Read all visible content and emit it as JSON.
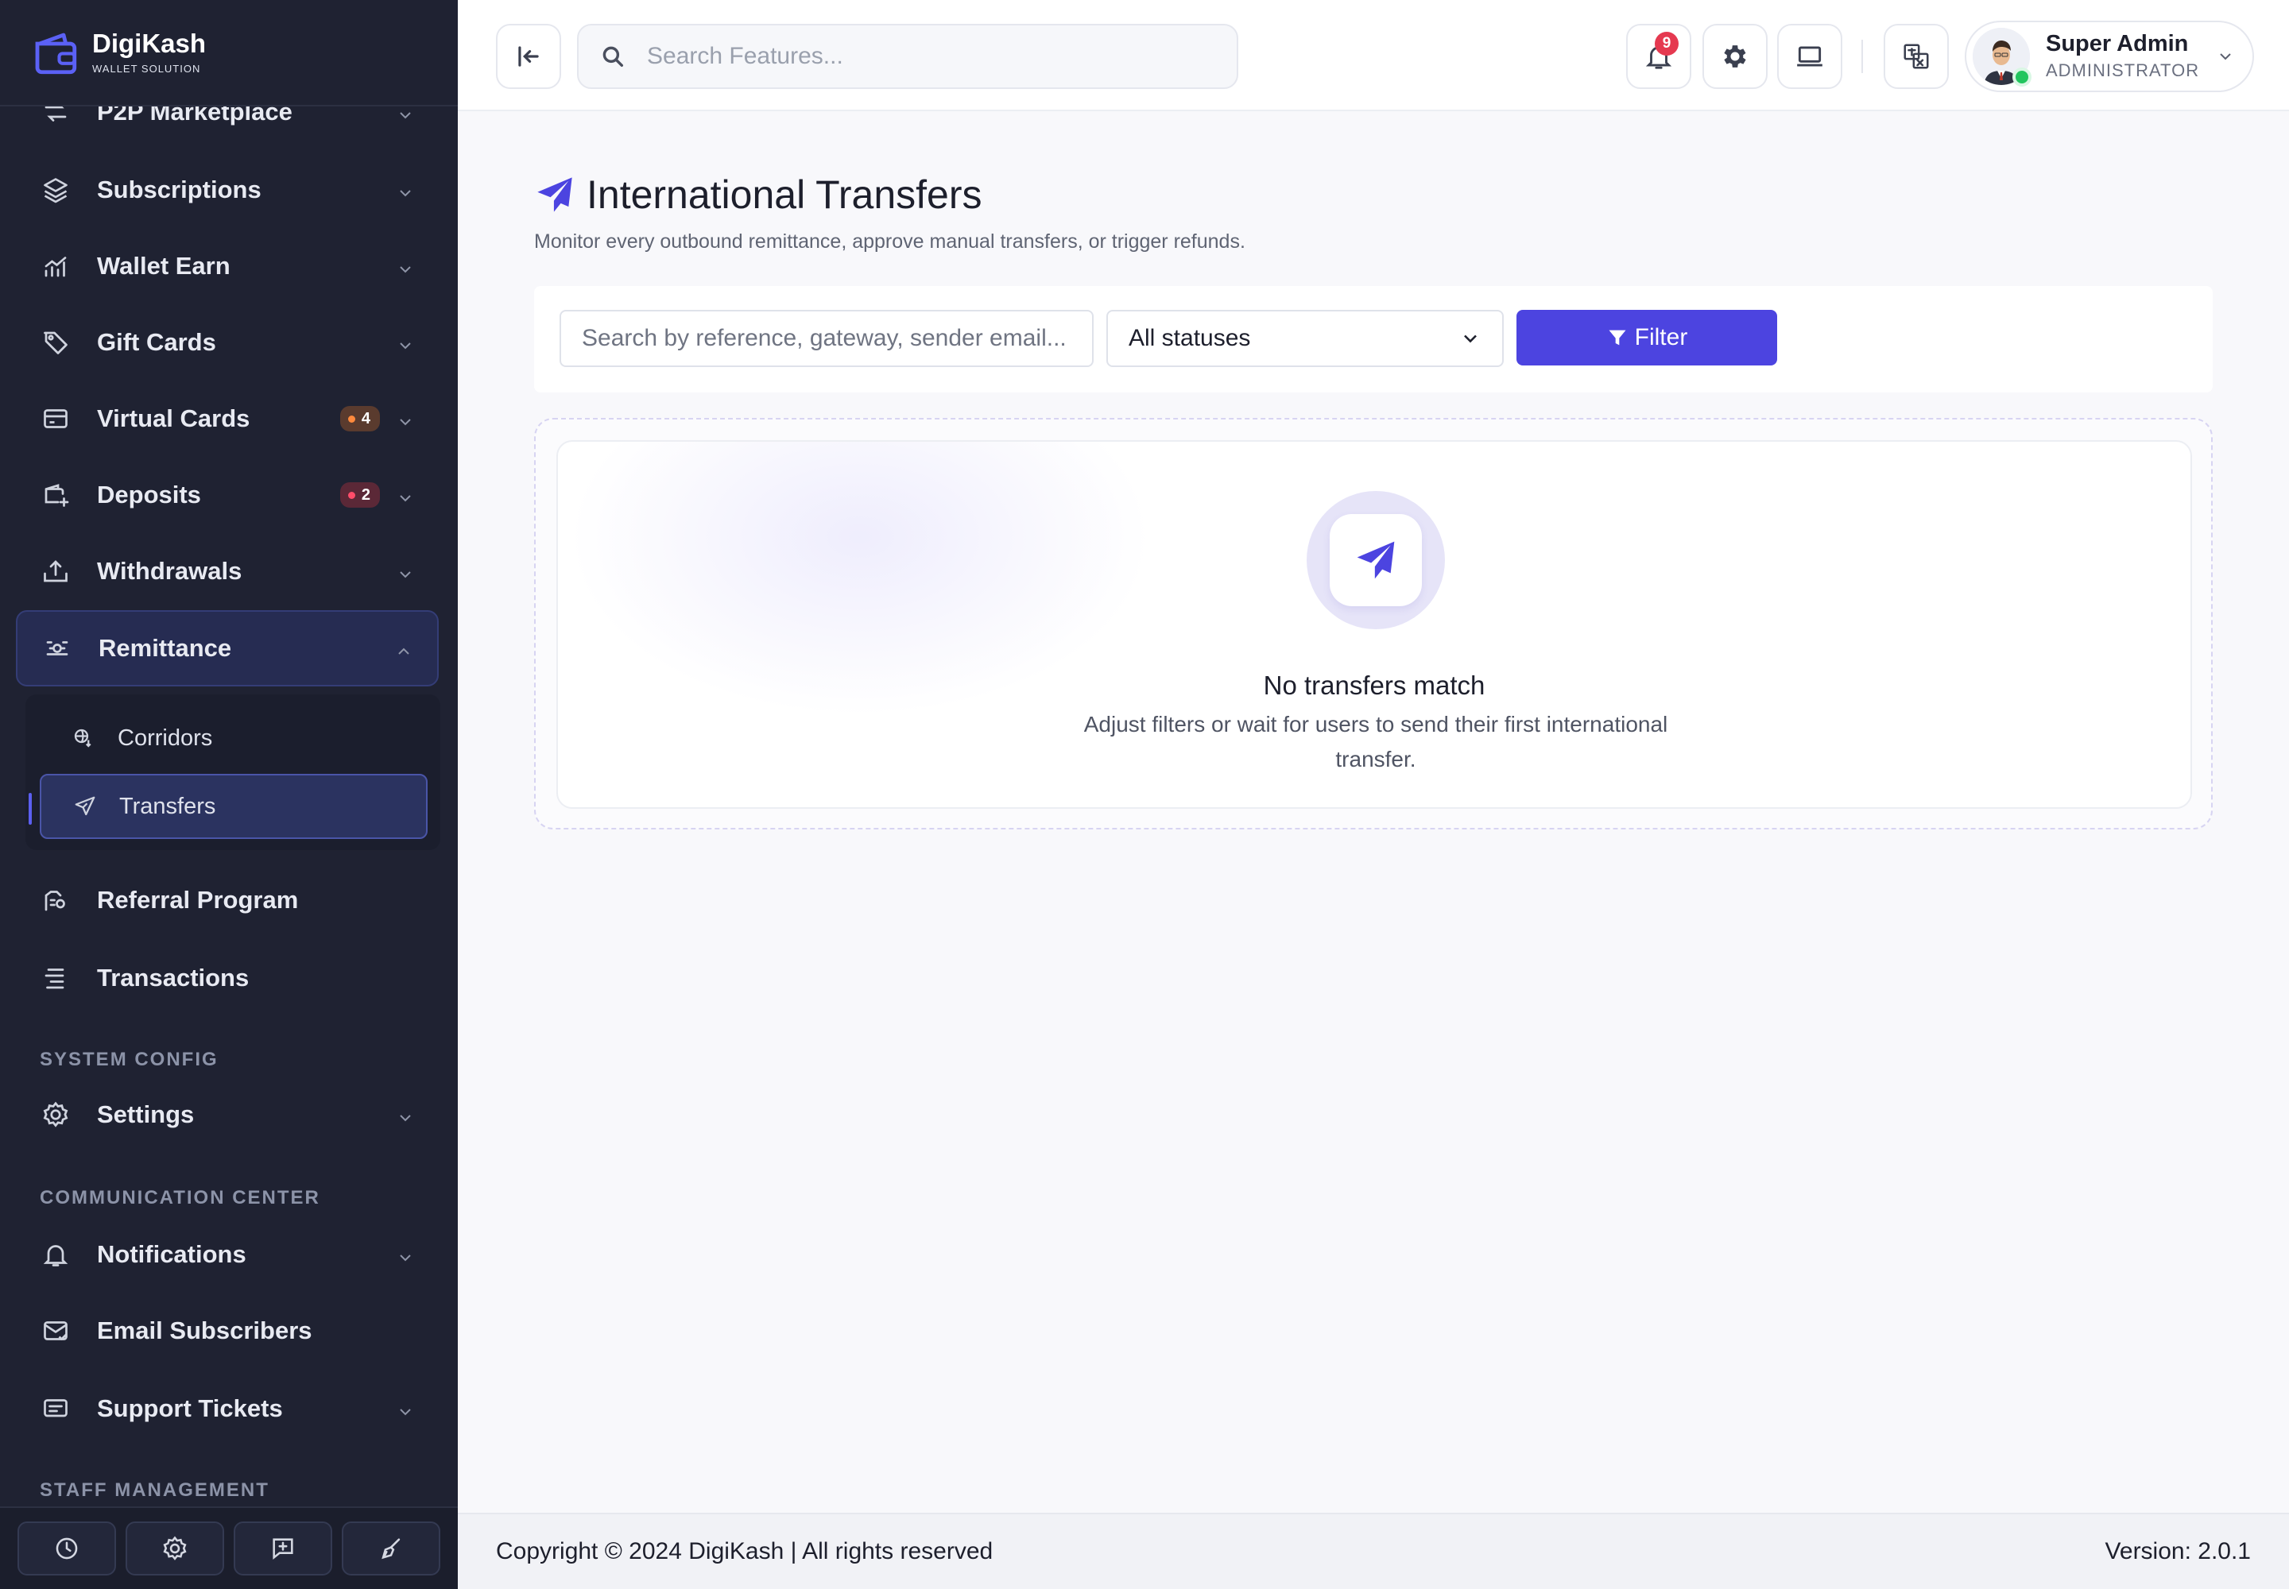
{
  "brand": {
    "name": "DigiKash",
    "tagline": "WALLET SOLUTION"
  },
  "sidebar": {
    "items": [
      {
        "label": "P2P Marketplace",
        "icon": "exchange-icon"
      },
      {
        "label": "Subscriptions",
        "icon": "layers-icon"
      },
      {
        "label": "Wallet Earn",
        "icon": "chart-growth-icon"
      },
      {
        "label": "Gift Cards",
        "icon": "tag-icon"
      },
      {
        "label": "Virtual Cards",
        "icon": "credit-card-icon",
        "badge": "4"
      },
      {
        "label": "Deposits",
        "icon": "wallet-plus-icon",
        "badge": "2"
      },
      {
        "label": "Withdrawals",
        "icon": "upload-tray-icon"
      },
      {
        "label": "Remittance",
        "icon": "remittance-icon"
      },
      {
        "label": "Referral Program",
        "icon": "referral-icon"
      },
      {
        "label": "Transactions",
        "icon": "list-icon"
      },
      {
        "label": "Settings",
        "icon": "gear-icon"
      },
      {
        "label": "Notifications",
        "icon": "bell-icon"
      },
      {
        "label": "Email Subscribers",
        "icon": "mail-check-icon"
      },
      {
        "label": "Support Tickets",
        "icon": "ticket-message-icon"
      }
    ],
    "remittance_sub": [
      {
        "label": "Corridors",
        "icon": "globe-pin-icon"
      },
      {
        "label": "Transfers",
        "icon": "send-icon"
      }
    ],
    "sections": {
      "system_config": "SYSTEM CONFIG",
      "communication_center": "COMMUNICATION CENTER",
      "staff_management": "STAFF MANAGEMENT"
    },
    "footer_buttons": [
      "clock-icon",
      "settings-icon",
      "message-plus-icon",
      "broom-icon"
    ]
  },
  "topbar": {
    "search_placeholder": "Search Features...",
    "notification_count": "9",
    "user": {
      "name": "Super Admin",
      "role": "ADMINISTRATOR"
    }
  },
  "page": {
    "title": "International Transfers",
    "subtitle": "Monitor every outbound remittance, approve manual transfers, or trigger refunds.",
    "filter": {
      "search_placeholder": "Search by reference, gateway, sender email...",
      "status_value": "All statuses",
      "button_label": "Filter"
    },
    "empty": {
      "title": "No transfers match",
      "description": "Adjust filters or wait for users to send their first international transfer."
    }
  },
  "footer": {
    "copyright": "Copyright © 2024 DigiKash | All rights reserved",
    "version": "Version: 2.0.1"
  },
  "colors": {
    "accent": "#4c44e0",
    "sidebar_bg": "#1f2232",
    "badge_orange": "#ff8a3d",
    "badge_red": "#ff4d6a",
    "notification_red": "#e53950",
    "online_green": "#22c55e"
  }
}
